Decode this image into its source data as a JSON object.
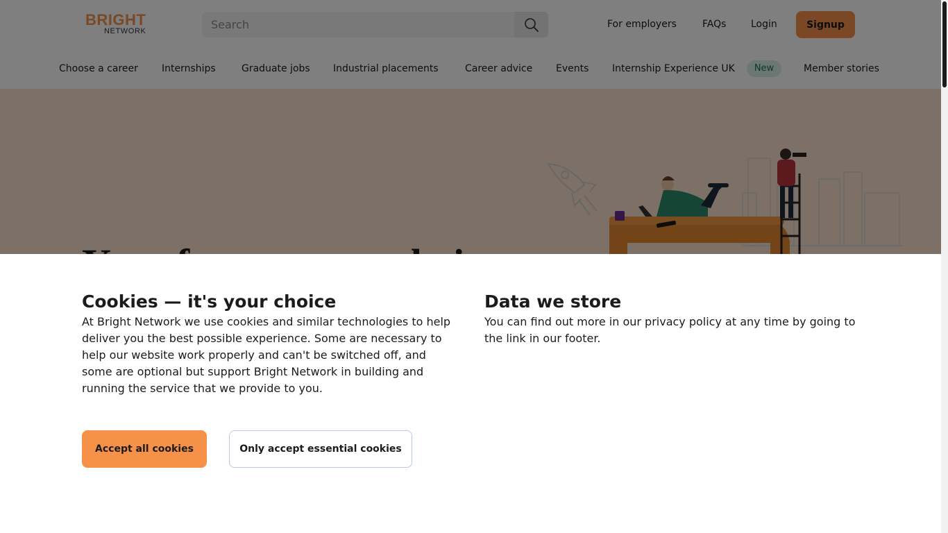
{
  "header": {
    "logo": {
      "word1": "BRIGHT",
      "word2": "NETWORK"
    },
    "search": {
      "placeholder": "Search",
      "icon": "search-icon"
    },
    "links": {
      "employers": "For employers",
      "faqs": "FAQs",
      "login": "Login"
    },
    "signup_label": "Signup"
  },
  "nav": {
    "items": [
      "Choose a career",
      "Internships",
      "Graduate jobs",
      "Industrial placements",
      "Career advice",
      "Events",
      "Internship Experience UK",
      "Member stories"
    ],
    "badge": "New"
  },
  "hero": {
    "title_partial": "Your future, your choice"
  },
  "cookie": {
    "title": "Cookies — it's your choice",
    "text": "At Bright Network we use cookies and similar technologies to help deliver you the best possible experience. Some are necessary to help our website work properly and can't be switched off, and some are optional but support Bright Network in building and running the service that we provide to you.",
    "data_title": "Data we store",
    "data_text": "You can find out more in our privacy policy at any time by going to the link in our footer.",
    "accept_label": "Accept all cookies",
    "essential_label": "Only accept essential cookies"
  },
  "colors": {
    "accent": "#f6914a",
    "hero_bg": "#fbe3cf",
    "badge_bg": "#d7eee6",
    "badge_text": "#1f6b55"
  }
}
